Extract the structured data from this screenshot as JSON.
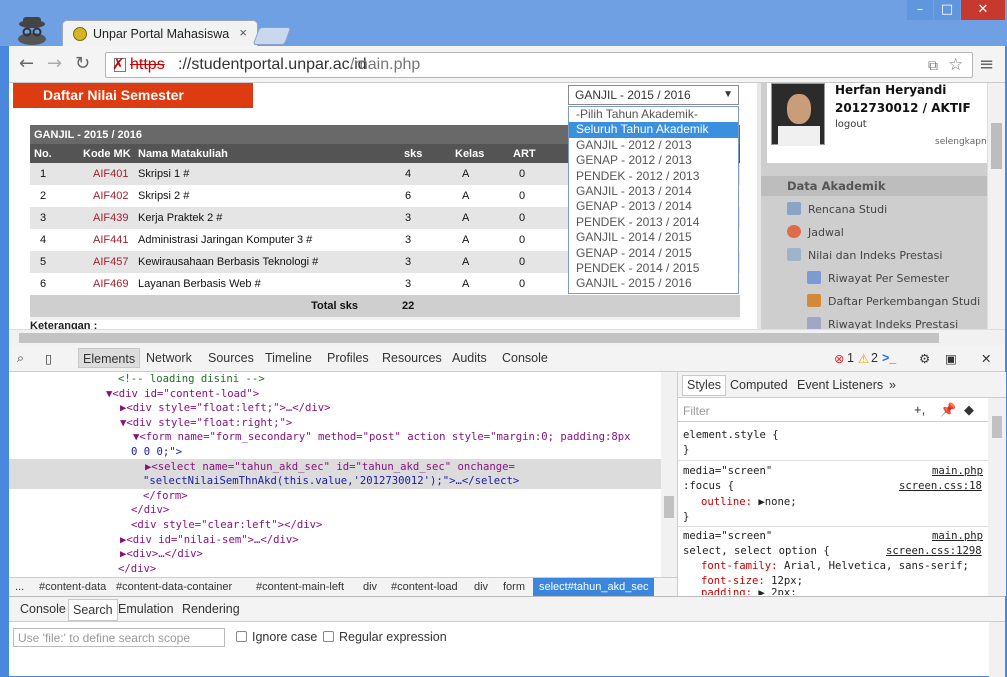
{
  "browser": {
    "tab_title": "Unpar Portal Mahasiswa",
    "tab_close": "×",
    "url_scheme": "https",
    "url_host": "://studentportal.unpar.ac.id",
    "url_path": "/main.php",
    "window_buttons": {
      "minimize": "–",
      "maximize": "□",
      "close": "✕"
    }
  },
  "page": {
    "title": "Daftar Nilai Semester",
    "select_value": "GANJIL - 2015 / 2016",
    "dropdown_options": [
      "-Pilih Tahun Akademik-",
      "Seluruh Tahun Akademik",
      "GANJIL - 2012 / 2013",
      "GENAP - 2012 / 2013",
      "PENDEK - 2012 / 2013",
      "GANJIL - 2013 / 2014",
      "GENAP - 2013 / 2014",
      "PENDEK - 2013 / 2014",
      "GANJIL - 2014 / 2015",
      "GENAP - 2014 / 2015",
      "PENDEK - 2014 / 2015",
      "GANJIL - 2015 / 2016"
    ],
    "dropdown_highlighted": "Seluruh Tahun Akademik",
    "table": {
      "semester_label": "GANJIL - 2015 / 2016",
      "headers": [
        "No.",
        "Kode MK",
        "Nama Matakuliah",
        "sks",
        "Kelas",
        "ART"
      ],
      "rows": [
        {
          "no": "1",
          "kode": "AIF401",
          "nama": "Skripsi 1 #",
          "sks": "4",
          "kelas": "A",
          "art": "0"
        },
        {
          "no": "2",
          "kode": "AIF402",
          "nama": "Skripsi 2 #",
          "sks": "6",
          "kelas": "A",
          "art": "0"
        },
        {
          "no": "3",
          "kode": "AIF439",
          "nama": "Kerja Praktek 2 #",
          "sks": "3",
          "kelas": "A",
          "art": "0"
        },
        {
          "no": "4",
          "kode": "AIF441",
          "nama": "Administrasi Jaringan Komputer 3 #",
          "sks": "3",
          "kelas": "A",
          "art": "0"
        },
        {
          "no": "5",
          "kode": "AIF457",
          "nama": "Kewirausahaan Berbasis Teknologi #",
          "sks": "3",
          "kelas": "A",
          "art": "0"
        },
        {
          "no": "6",
          "kode": "AIF469",
          "nama": "Layanan Berbasis Web #",
          "sks": "3",
          "kelas": "A",
          "art": "0"
        }
      ],
      "total_label": "Total sks",
      "total_value": "22"
    },
    "keterangan": "Keterangan :"
  },
  "sidebar": {
    "user_name": "Herfan Heryandi",
    "user_id_status": "2012730012 / AKTIF",
    "logout": "logout",
    "more": "selengkapnya",
    "section": "Data Akademik",
    "items": [
      "Rencana Studi",
      "Jadwal",
      "Nilai dan Indeks Prestasi"
    ],
    "subitems": [
      "Riwayat Per Semester",
      "Daftar Perkembangan Studi",
      "Riwayat Indeks Prestasi"
    ]
  },
  "devtools": {
    "tabs": [
      "Elements",
      "Network",
      "Sources",
      "Timeline",
      "Profiles",
      "Resources",
      "Audits",
      "Console"
    ],
    "errors": "1",
    "warnings": "2",
    "dom": [
      "<!-- loading disini -->",
      "<div id=\"content-load\">",
      "<div style=\"float:left;\">…</div>",
      "<div style=\"float:right;\">",
      "<form name=\"form_secondary\" method=\"post\" action style=\"margin:0; padding:8px",
      "0 0 0;\">",
      "<select name=\"tahun_akd_sec\" id=\"tahun_akd_sec\" onchange=",
      "\"selectNilaiSemThnAkd(this.value,'2012730012');\">…</select>",
      "</form>",
      "</div>",
      "<div style=\"clear:left\"></div>",
      "<div id=\"nilai-sem\">…</div>",
      "<div>…</div>",
      "</div>"
    ],
    "breadcrumbs": [
      "...",
      "#content-data",
      "#content-data-container",
      "#content-main-left",
      "div",
      "#content-load",
      "div",
      "form",
      "select#tahun_akd_sec"
    ],
    "style_tabs": [
      "Styles",
      "Computed",
      "Event Listeners",
      "»"
    ],
    "filter_placeholder": "Filter",
    "styles": {
      "element_style": "element.style {",
      "close": "}",
      "media": "media=\"screen\"",
      "src_main": "main.php",
      "focus_sel": ":focus {",
      "src_css18": "screen.css:18",
      "outline": "outline:",
      "outline_val": "▶none;",
      "select_sel": "select, select option {",
      "src_css1298": "screen.css:1298",
      "ff": "font-family:",
      "ff_val": "Arial, Helvetica, sans-serif;",
      "fs": "font-size:",
      "fs_val": "12px;",
      "pd": "padding:",
      "pd_val": "▶ 2px;"
    },
    "drawer_tabs": [
      "Console",
      "Search",
      "Emulation",
      "Rendering"
    ],
    "search_placeholder": "Use 'file:' to define search scope",
    "ignore_case": "Ignore case",
    "regex": "Regular expression"
  }
}
